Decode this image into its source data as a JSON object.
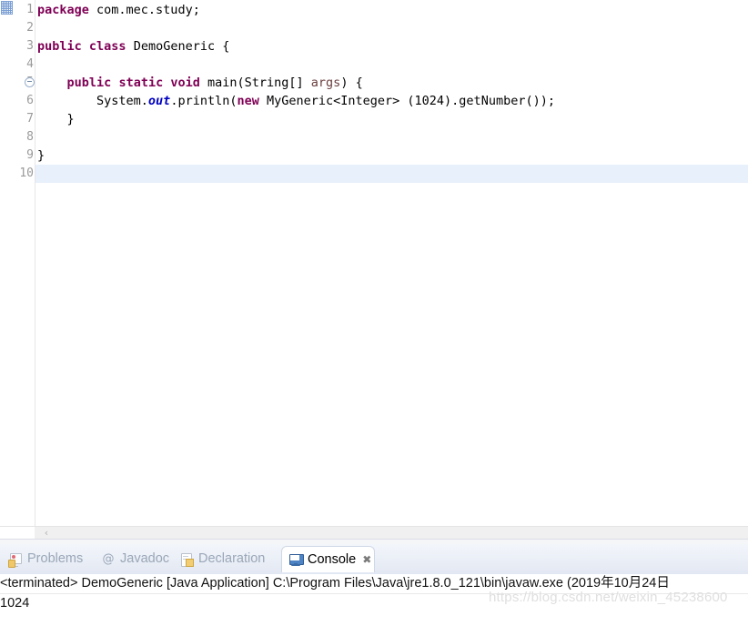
{
  "editor": {
    "lines": [
      {
        "num": "1",
        "fold": false,
        "current": false,
        "tokens": [
          {
            "t": "package",
            "c": "kw"
          },
          {
            "t": " com.mec.study;",
            "c": "plain"
          }
        ]
      },
      {
        "num": "2",
        "fold": false,
        "current": false,
        "tokens": []
      },
      {
        "num": "3",
        "fold": false,
        "current": false,
        "tokens": [
          {
            "t": "public",
            "c": "kw"
          },
          {
            "t": " ",
            "c": "plain"
          },
          {
            "t": "class",
            "c": "kw"
          },
          {
            "t": " DemoGeneric {",
            "c": "plain"
          }
        ]
      },
      {
        "num": "4",
        "fold": false,
        "current": false,
        "tokens": []
      },
      {
        "num": "5",
        "fold": true,
        "current": false,
        "tokens": [
          {
            "t": "    ",
            "c": "plain"
          },
          {
            "t": "public",
            "c": "kw"
          },
          {
            "t": " ",
            "c": "plain"
          },
          {
            "t": "static",
            "c": "kw"
          },
          {
            "t": " ",
            "c": "plain"
          },
          {
            "t": "void",
            "c": "kw"
          },
          {
            "t": " main(String[] ",
            "c": "plain"
          },
          {
            "t": "args",
            "c": "prm"
          },
          {
            "t": ") {",
            "c": "plain"
          }
        ]
      },
      {
        "num": "6",
        "fold": false,
        "current": false,
        "tokens": [
          {
            "t": "        System.",
            "c": "plain"
          },
          {
            "t": "out",
            "c": "fld"
          },
          {
            "t": ".println(",
            "c": "plain"
          },
          {
            "t": "new",
            "c": "kw"
          },
          {
            "t": " MyGeneric<Integer> (1024).getNumber());",
            "c": "plain"
          }
        ]
      },
      {
        "num": "7",
        "fold": false,
        "current": false,
        "tokens": [
          {
            "t": "    }",
            "c": "plain"
          }
        ]
      },
      {
        "num": "8",
        "fold": false,
        "current": false,
        "tokens": []
      },
      {
        "num": "9",
        "fold": false,
        "current": false,
        "tokens": [
          {
            "t": "}",
            "c": "plain"
          }
        ]
      },
      {
        "num": "10",
        "fold": false,
        "current": true,
        "tokens": []
      }
    ],
    "scrollbar": {
      "left_arrow": "‹"
    }
  },
  "bottom_panel": {
    "tabs": [
      {
        "label": "Problems",
        "icon": "problems-icon",
        "active": false,
        "closable": false
      },
      {
        "label": "Javadoc",
        "icon": "javadoc-icon",
        "active": false,
        "closable": false
      },
      {
        "label": "Declaration",
        "icon": "declaration-icon",
        "active": false,
        "closable": false
      },
      {
        "label": "Console",
        "icon": "console-icon",
        "active": true,
        "closable": true
      }
    ],
    "tab_close_glyph": "✖",
    "javadoc_glyph": "@"
  },
  "console": {
    "header": "<terminated> DemoGeneric [Java Application] C:\\Program Files\\Java\\jre1.8.0_121\\bin\\javaw.exe (2019年10月24日",
    "output": "1024"
  },
  "watermark": {
    "text": "https://blog.csdn.net/weixin_45238600"
  },
  "colors": {
    "keyword": "#7f0055",
    "static_field": "#0000c0",
    "parameter": "#6a3e3e",
    "current_line_highlight": "#e8f0fb",
    "console_icon_blue": "#4e84c4",
    "tab_inactive_text": "#9aa7b8"
  }
}
